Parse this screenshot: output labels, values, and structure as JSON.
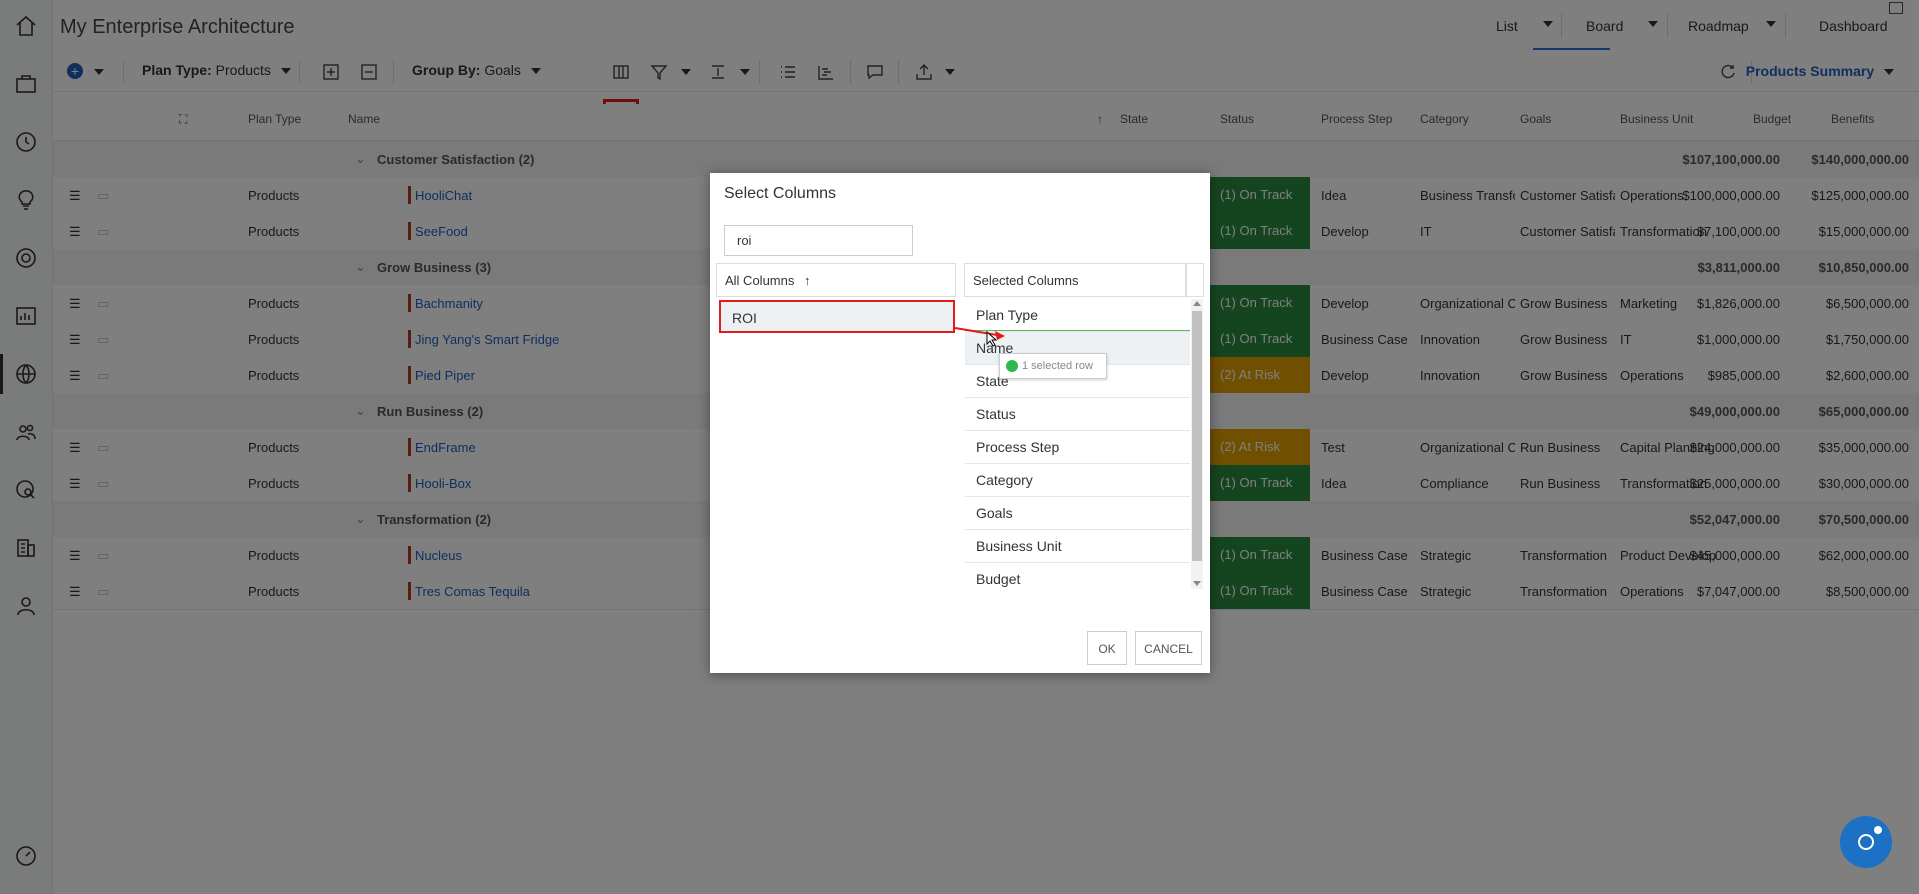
{
  "app": {
    "title": "My Enterprise Architecture"
  },
  "view_tabs": [
    {
      "label": "List"
    },
    {
      "label": "Board"
    },
    {
      "label": "Roadmap"
    },
    {
      "label": "Dashboard"
    }
  ],
  "toolbar": {
    "plan_type_label": "Plan Type:",
    "plan_type_value": "Products",
    "group_by_label": "Group By:",
    "group_by_value": "Goals",
    "summary": "Products Summary"
  },
  "grid": {
    "headers": {
      "plan_type": "Plan Type",
      "name": "Name",
      "state": "State",
      "status": "Status",
      "process_step": "Process Step",
      "category": "Category",
      "goals": "Goals",
      "business_unit": "Business Unit",
      "budget": "Budget",
      "benefits": "Benefits"
    },
    "groups": [
      {
        "name": "Customer Satisfaction (2)",
        "budget": "$107,100,000.00",
        "benefits": "$140,000,000.00",
        "rows": [
          {
            "plan_type": "Products",
            "name": "HooliChat",
            "status": "(1) On Track",
            "process_step": "Idea",
            "category": "Business Transfo",
            "goals": "Customer Satisfa",
            "business_unit": "Operations",
            "budget": "$100,000,000.00",
            "benefits": "$125,000,000.00"
          },
          {
            "plan_type": "Products",
            "name": "SeeFood",
            "status": "(1) On Track",
            "process_step": "Develop",
            "category": "IT",
            "goals": "Customer Satisfa",
            "business_unit": "Transformation",
            "budget": "$7,100,000.00",
            "benefits": "$15,000,000.00"
          }
        ]
      },
      {
        "name": "Grow Business (3)",
        "budget": "$3,811,000.00",
        "benefits": "$10,850,000.00",
        "rows": [
          {
            "plan_type": "Products",
            "name": "Bachmanity",
            "status": "(1) On Track",
            "process_step": "Develop",
            "category": "Organizational C",
            "goals": "Grow Business",
            "business_unit": "Marketing",
            "budget": "$1,826,000.00",
            "benefits": "$6,500,000.00"
          },
          {
            "plan_type": "Products",
            "name": "Jing Yang's Smart Fridge",
            "status": "(1) On Track",
            "process_step": "Business Case",
            "category": "Innovation",
            "goals": "Grow Business",
            "business_unit": "IT",
            "budget": "$1,000,000.00",
            "benefits": "$1,750,000.00"
          },
          {
            "plan_type": "Products",
            "name": "Pied Piper",
            "status": "(2) At Risk",
            "process_step": "Develop",
            "category": "Innovation",
            "goals": "Grow Business",
            "business_unit": "Operations",
            "budget": "$985,000.00",
            "benefits": "$2,600,000.00"
          }
        ]
      },
      {
        "name": "Run Business (2)",
        "budget": "$49,000,000.00",
        "benefits": "$65,000,000.00",
        "rows": [
          {
            "plan_type": "Products",
            "name": "EndFrame",
            "status": "(2) At Risk",
            "process_step": "Test",
            "category": "Organizational C",
            "goals": "Run Business",
            "business_unit": "Capital Planning",
            "budget": "$24,000,000.00",
            "benefits": "$35,000,000.00"
          },
          {
            "plan_type": "Products",
            "name": "Hooli-Box",
            "status": "(1) On Track",
            "process_step": "Idea",
            "category": "Compliance",
            "goals": "Run Business",
            "business_unit": "Transformation",
            "budget": "$25,000,000.00",
            "benefits": "$30,000,000.00"
          }
        ]
      },
      {
        "name": "Transformation (2)",
        "budget": "$52,047,000.00",
        "benefits": "$70,500,000.00",
        "rows": [
          {
            "plan_type": "Products",
            "name": "Nucleus",
            "status": "(1) On Track",
            "process_step": "Business Case",
            "category": "Strategic",
            "goals": "Transformation",
            "business_unit": "Product Develop",
            "budget": "$45,000,000.00",
            "benefits": "$62,000,000.00"
          },
          {
            "plan_type": "Products",
            "name": "Tres Comas Tequila",
            "status": "(1) On Track",
            "process_step": "Business Case",
            "category": "Strategic",
            "goals": "Transformation",
            "business_unit": "Operations",
            "budget": "$7,047,000.00",
            "benefits": "$8,500,000.00"
          }
        ]
      }
    ]
  },
  "dialog": {
    "title": "Select Columns",
    "search_value": "roi",
    "all_columns_header": "All Columns",
    "selected_columns_header": "Selected Columns",
    "all_columns": [
      "ROI"
    ],
    "selected_columns": [
      "Plan Type",
      "Name",
      "State",
      "Status",
      "Process Step",
      "Category",
      "Goals",
      "Business Unit",
      "Budget"
    ],
    "drag_tooltip": "1 selected row",
    "ok_label": "OK",
    "cancel_label": "CANCEL"
  },
  "colors": {
    "on_track": "#2a8a3e",
    "at_risk": "#e0a100",
    "link": "#1f5fbf",
    "highlight": "#e21b1b"
  }
}
